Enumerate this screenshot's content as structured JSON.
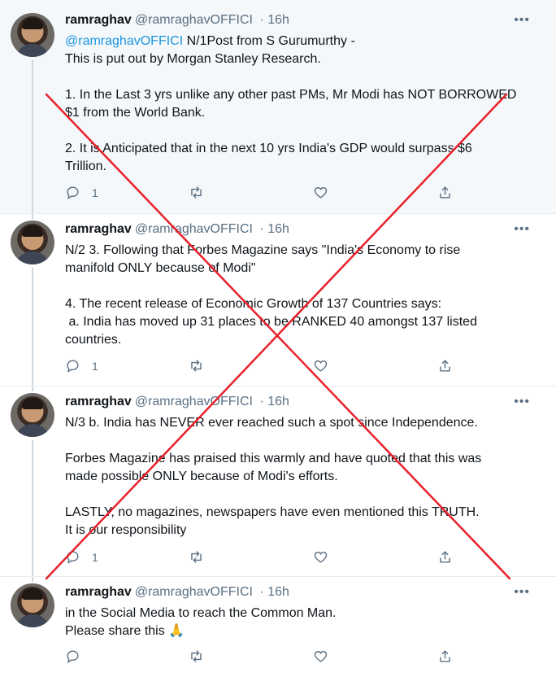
{
  "user": {
    "name": "ramraghav",
    "handle": "@ramraghavOFFICI",
    "time": "· 16h"
  },
  "icons": {
    "reply": "reply-icon",
    "retweet": "retweet-icon",
    "like": "heart-icon",
    "share": "share-icon",
    "more": "more-icon",
    "prayer": "folded-hands-emoji"
  },
  "colors": {
    "accent": "#1b95e0",
    "muted": "#5b7083",
    "cross": "#e8202a"
  },
  "more_glyph": "•••",
  "tweets": [
    {
      "mention": "@ramraghavOFFICI",
      "lines": [
        " N/1Post from S Gurumurthy -",
        "This is put out by Morgan Stanley Research.",
        "",
        "1. In the Last 3 yrs unlike any other past PMs, Mr Modi has NOT BORROWED",
        "$1 from the World Bank.",
        "",
        "2. It is Anticipated that in the next 10 yrs India's GDP would surpass $6",
        "Trillion."
      ],
      "reply_count": "1"
    },
    {
      "lines": [
        "N/2 3. Following that Forbes Magazine says \"India's Economy to rise",
        "manifold ONLY because of Modi\"",
        "",
        "4. The recent release of Economic Growth of 137 Countries says:",
        " a. India has moved up 31 places to be RANKED 40 amongst 137 listed",
        "countries."
      ],
      "reply_count": "1"
    },
    {
      "lines": [
        "N/3 b. India has NEVER ever reached such a spot since Independence.",
        "",
        "Forbes Magazine has praised this warmly and have quoted that this was",
        "made possible ONLY because of Modi's efforts.",
        "",
        "LASTLY, no magazines, newspapers have even mentioned this TRUTH.",
        "It is our responsibility"
      ],
      "reply_count": "1"
    },
    {
      "lines": [
        "in the Social Media to reach the Common Man.",
        "Please share this "
      ],
      "emoji": "🙏",
      "reply_count": ""
    }
  ]
}
